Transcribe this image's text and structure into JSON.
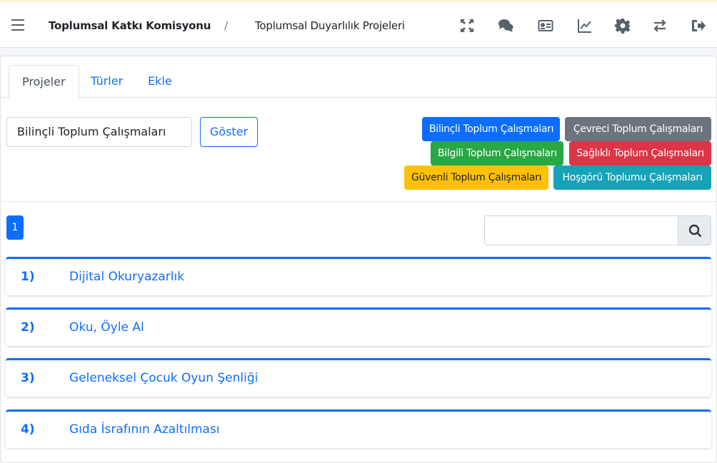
{
  "header": {
    "breadcrumb_main": "Toplumsal Katkı Komisyonu",
    "breadcrumb_sep": "/",
    "breadcrumb_sub": "Toplumsal Duyarlılık Projeleri",
    "icons": [
      "menu-icon",
      "expand-icon",
      "comments-icon",
      "id-card-icon",
      "chart-line-icon",
      "gear-icon",
      "exchange-icon",
      "logout-icon"
    ]
  },
  "tabs": [
    {
      "label": "Projeler",
      "active": true
    },
    {
      "label": "Türler",
      "active": false
    },
    {
      "label": "Ekle",
      "active": false
    }
  ],
  "filter": {
    "selected": "Bilinçli Toplum Çalışmaları",
    "show_label": "Göster"
  },
  "categories": [
    {
      "label": "Bilinçli Toplum Çalışmaları",
      "color": "#0d6efd"
    },
    {
      "label": "Çevreci Toplum Çalışmaları",
      "color": "#6c757d"
    },
    {
      "label": "Bilgili Toplum Çalışmaları",
      "color": "#28a745"
    },
    {
      "label": "Sağlıklı Toplum Çalışmaları",
      "color": "#dc3545"
    },
    {
      "label": "Güvenli Toplum Çalışmaları",
      "color": "#ffc107",
      "text_color": "#212529"
    },
    {
      "label": "Hoşgörü Toplumu Çalışmaları",
      "color": "#17a2b8"
    }
  ],
  "pagination": {
    "current": "1"
  },
  "search": {
    "placeholder": "",
    "icon": "search-icon"
  },
  "projects": [
    {
      "number": "1)",
      "title": "Dijital Okuryazarlık"
    },
    {
      "number": "2)",
      "title": "Oku, Öyle Al"
    },
    {
      "number": "3)",
      "title": "Geleneksel Çocuk Oyun Şenliği"
    },
    {
      "number": "4)",
      "title": "Gıda İsrafının Azaltılması"
    }
  ],
  "colors": {
    "accent": "#0d6efd"
  }
}
